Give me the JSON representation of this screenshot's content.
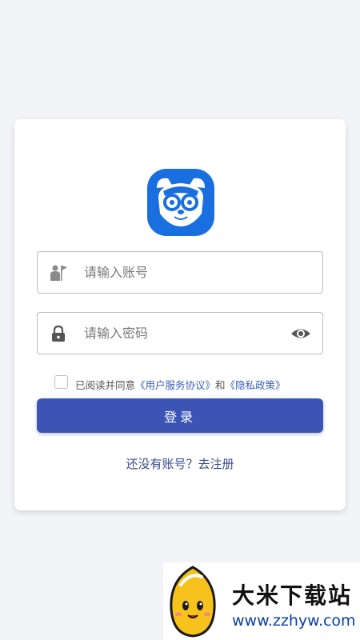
{
  "login": {
    "account_placeholder": "请输入账号",
    "password_placeholder": "请输入密码",
    "agree_prefix": "已阅读并同意",
    "terms_link": "《用户服务协议》",
    "and_text": "和",
    "privacy_link": "《隐私政策》",
    "login_button": "登录",
    "register_link": "还没有账号？去注册"
  },
  "icons": {
    "logo": "raccoon-goggles-logo",
    "account": "user-flag-icon",
    "password": "lock-icon",
    "toggle": "eye-icon"
  },
  "colors": {
    "accent": "#3c55b4",
    "logo_blue": "#1a6fe0",
    "link": "#3b5fb8"
  },
  "watermark": {
    "title": "大米下载站",
    "url": "www.zzhyw.com"
  }
}
